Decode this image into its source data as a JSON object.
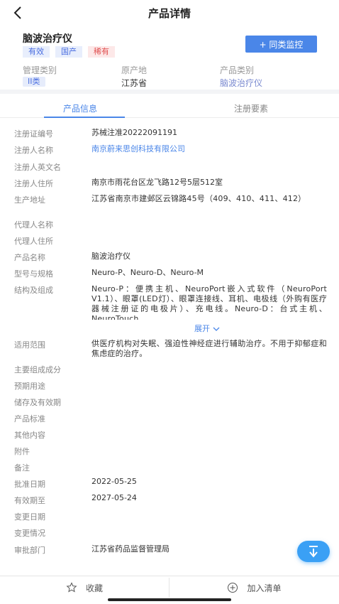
{
  "topbar": {
    "title": "产品详情",
    "back_icon": "chevron-left-icon"
  },
  "header": {
    "product_name": "脑波治疗仪",
    "tags": [
      "有效",
      "国产",
      "稀有"
    ],
    "monitor_button": "+ 同类监控",
    "meta": [
      {
        "label": "管理类别",
        "value": "II类"
      },
      {
        "label": "原产地",
        "value": "江苏省"
      },
      {
        "label": "产品类别",
        "value": "脑波治疗仪"
      }
    ]
  },
  "tabs": [
    "产品信息",
    "注册要素"
  ],
  "info_rows": [
    {
      "label": "注册证编号",
      "value": "苏械注准20222091191"
    },
    {
      "label": "注册人名称",
      "value": "南京蔚来思创科技有限公司"
    },
    {
      "label": "注册人英文名",
      "value": ""
    },
    {
      "label": "注册人住所",
      "value": "南京市雨花台区龙飞路12号5层512室"
    },
    {
      "label": "生产地址",
      "value": "江苏省南京市建邺区云锦路45号（409、410、411、412）"
    },
    {
      "label": "代理人名称",
      "value": ""
    },
    {
      "label": "代理人住所",
      "value": ""
    },
    {
      "label": "产品名称",
      "value": "脑波治疗仪"
    },
    {
      "label": "型号与规格",
      "value": "Neuro-P、Neuro-D、Neuro-M"
    },
    {
      "label": "结构及组成",
      "value": "Neuro-P：便携主机、NeuroPort嵌入式软件（NeuroPort V1.1）、眼罩(LED灯）、眼罩连接线、耳机、电极线（外购有医疗器械注册证的电极片）、充电线。Neuro-D：台式主机、NeuroTouch"
    },
    {
      "label": "适用范围",
      "value": "供医疗机构对失眠、强迫性神经症进行辅助治疗。不用于抑郁症和焦虑症的治疗。"
    },
    {
      "label": "主要组成成分",
      "value": ""
    },
    {
      "label": "预期用途",
      "value": ""
    },
    {
      "label": "储存及有效期",
      "value": ""
    },
    {
      "label": "产品标准",
      "value": ""
    },
    {
      "label": "其他内容",
      "value": ""
    },
    {
      "label": "附件",
      "value": ""
    },
    {
      "label": "备注",
      "value": ""
    },
    {
      "label": "批准日期",
      "value": "2022-05-25"
    },
    {
      "label": "有效期至",
      "value": "2027-05-24"
    },
    {
      "label": "变更日期",
      "value": ""
    },
    {
      "label": "变更情况",
      "value": ""
    },
    {
      "label": "审批部门",
      "value": "江苏省药品监督管理局"
    }
  ],
  "expand_label": "展开",
  "fab_icon": "arrow-down-icon",
  "bottom": {
    "favorite": "收藏",
    "add_list": "加入清单"
  },
  "colors": {
    "accent": "#4a86e8",
    "fab": "#3aa0f5",
    "rare_tag": "#e05050"
  }
}
